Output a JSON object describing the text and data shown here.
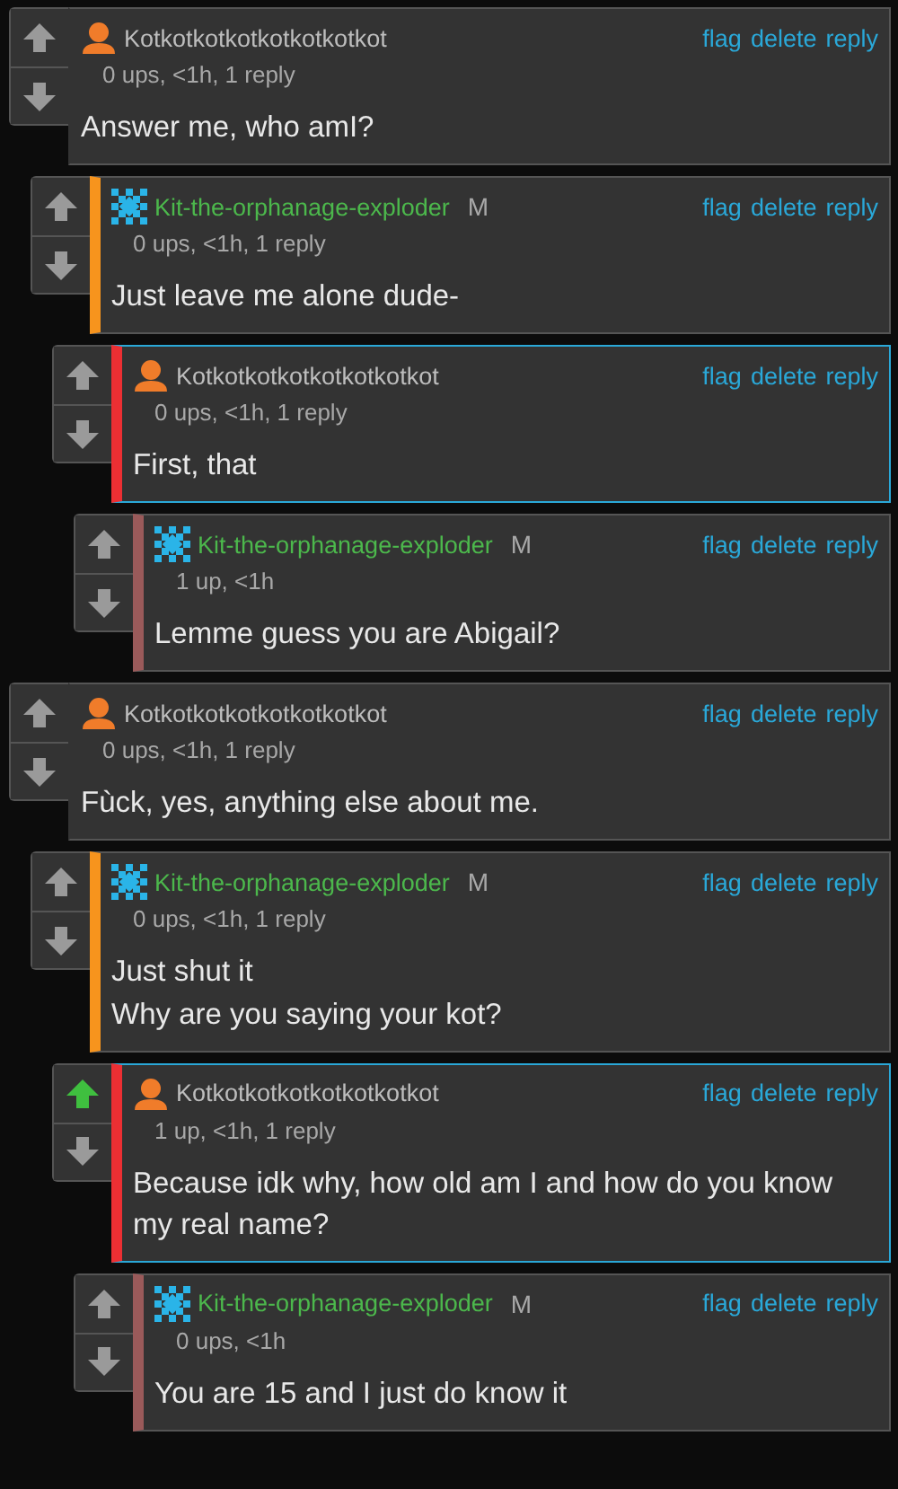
{
  "threads": [
    {
      "author": "Kotkotkotkotkotkotkotkot",
      "kind": "person",
      "stats": "0 ups, <1h, 1 reply",
      "text": "Answer me, who amI?",
      "highlighted": false,
      "upvoted": false,
      "actions": [
        "flag",
        "delete",
        "reply"
      ],
      "children": [
        {
          "author": "Kit-the-orphanage-exploder",
          "kind": "pixel",
          "mod_badge": "M",
          "stats": "0 ups, <1h, 1 reply",
          "text": "Just leave me alone dude-",
          "highlighted": false,
          "upvoted": false,
          "actions": [
            "flag",
            "delete",
            "reply"
          ],
          "children": [
            {
              "author": "Kotkotkotkotkotkotkotkot",
              "kind": "person",
              "stats": "0 ups, <1h, 1 reply",
              "text": "First, that",
              "highlighted": true,
              "upvoted": false,
              "actions": [
                "flag",
                "delete",
                "reply"
              ],
              "children": [
                {
                  "author": "Kit-the-orphanage-exploder",
                  "kind": "pixel",
                  "mod_badge": "M",
                  "stats": "1 up, <1h",
                  "text": "Lemme guess you are Abigail?",
                  "highlighted": false,
                  "upvoted": false,
                  "actions": [
                    "flag",
                    "delete",
                    "reply"
                  ]
                }
              ]
            }
          ]
        }
      ]
    },
    {
      "author": "Kotkotkotkotkotkotkotkot",
      "kind": "person",
      "stats": "0 ups, <1h, 1 reply",
      "text": "Fùck, yes, anything else about me.",
      "highlighted": false,
      "upvoted": false,
      "actions": [
        "flag",
        "delete",
        "reply"
      ],
      "children": [
        {
          "author": "Kit-the-orphanage-exploder",
          "kind": "pixel",
          "mod_badge": "M",
          "stats": "0 ups, <1h, 1 reply",
          "text": "Just shut it\nWhy are you saying your kot?",
          "highlighted": false,
          "upvoted": false,
          "actions": [
            "flag",
            "delete",
            "reply"
          ],
          "children": [
            {
              "author": "Kotkotkotkotkotkotkotkot",
              "kind": "person",
              "stats": "1 up, <1h, 1 reply",
              "text": "Because idk why, how old am I and how do you know my real name?",
              "highlighted": true,
              "upvoted": true,
              "actions": [
                "flag",
                "delete",
                "reply"
              ],
              "children": [
                {
                  "author": "Kit-the-orphanage-exploder",
                  "kind": "pixel",
                  "mod_badge": "M",
                  "stats": "0 ups, <1h",
                  "text": "You are 15 and I just do know it",
                  "highlighted": false,
                  "upvoted": false,
                  "actions": [
                    "flag",
                    "delete",
                    "reply"
                  ]
                }
              ]
            }
          ]
        }
      ]
    }
  ]
}
